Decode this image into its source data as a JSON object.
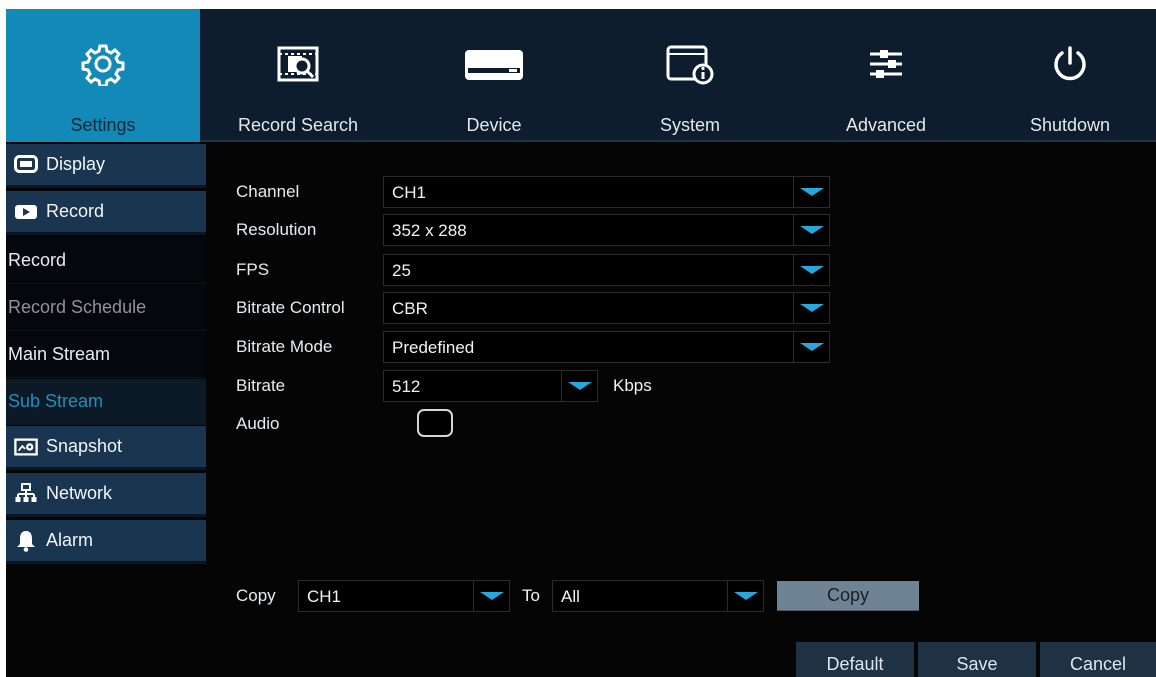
{
  "top_nav": {
    "tabs": [
      {
        "label": "Settings",
        "icon": "gear-icon",
        "active": true
      },
      {
        "label": "Record Search",
        "icon": "record-search-icon",
        "active": false
      },
      {
        "label": "Device",
        "icon": "hard-drive-icon",
        "active": false
      },
      {
        "label": "System",
        "icon": "system-info-icon",
        "active": false
      },
      {
        "label": "Advanced",
        "icon": "sliders-icon",
        "active": false
      },
      {
        "label": "Shutdown",
        "icon": "power-icon",
        "active": false
      }
    ]
  },
  "sidebar": {
    "items": [
      {
        "label": "Display",
        "type": "category",
        "icon": "monitor-icon"
      },
      {
        "label": "Record",
        "type": "category",
        "icon": "video-icon"
      },
      {
        "label": "Record",
        "type": "sub"
      },
      {
        "label": "Record Schedule",
        "type": "sub",
        "dim": true
      },
      {
        "label": "Main Stream",
        "type": "sub"
      },
      {
        "label": "Sub Stream",
        "type": "sub",
        "active": true
      },
      {
        "label": "Snapshot",
        "type": "category",
        "icon": "snapshot-icon"
      },
      {
        "label": "Network",
        "type": "category",
        "icon": "network-icon"
      },
      {
        "label": "Alarm",
        "type": "category",
        "icon": "bell-icon"
      }
    ]
  },
  "form": {
    "channel": {
      "label": "Channel",
      "value": "CH1"
    },
    "resolution": {
      "label": "Resolution",
      "value": "352 x 288"
    },
    "fps": {
      "label": "FPS",
      "value": "25"
    },
    "bitrate_control": {
      "label": "Bitrate Control",
      "value": "CBR"
    },
    "bitrate_mode": {
      "label": "Bitrate Mode",
      "value": "Predefined"
    },
    "bitrate": {
      "label": "Bitrate",
      "value": "512",
      "unit": "Kbps"
    },
    "audio": {
      "label": "Audio",
      "checked": false
    }
  },
  "copy_section": {
    "label": "Copy",
    "from_value": "CH1",
    "to_label": "To",
    "to_value": "All",
    "button": "Copy"
  },
  "footer": {
    "default_label": "Default",
    "save_label": "Save",
    "cancel_label": "Cancel"
  },
  "colors": {
    "accent": "#1389b7",
    "arrow": "#25a8de",
    "nav_bg": "#0d1d2e",
    "sidebar_category_bg": "#1a3550"
  }
}
